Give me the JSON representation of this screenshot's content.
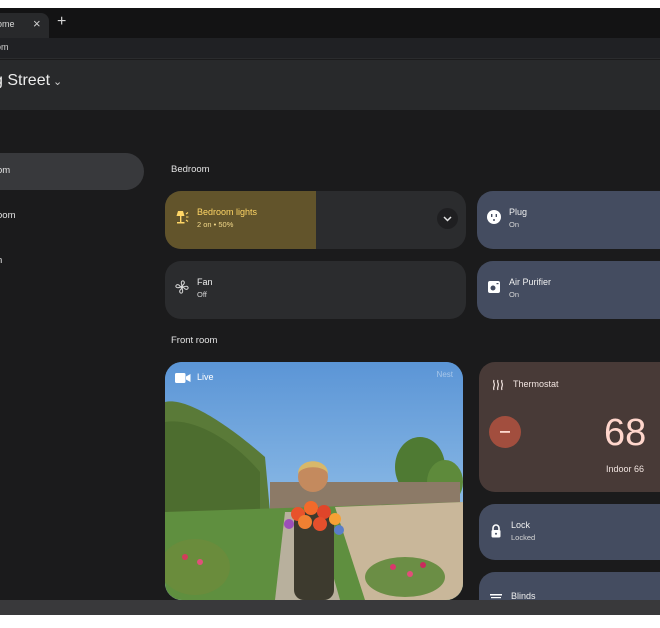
{
  "browser": {
    "tab_title": "ome",
    "close_glyph": "×",
    "new_tab_glyph": "+",
    "url": "om"
  },
  "header": {
    "home_name": "g Street",
    "chevron": "⌄"
  },
  "sidebar": {
    "items": [
      {
        "label": "om",
        "active": true
      },
      {
        "label": "oom",
        "active": false
      },
      {
        "label": "n",
        "active": false
      }
    ]
  },
  "sections": {
    "bedroom": "Bedroom",
    "front_room": "Front room"
  },
  "tiles": {
    "bedroom_lights": {
      "name": "Bedroom lights",
      "state": "2 on • 50%",
      "icon": "lamp-icon",
      "brightness": 0.5
    },
    "plug": {
      "name": "Plug",
      "state": "On",
      "icon": "outlet-icon"
    },
    "fan": {
      "name": "Fan",
      "state": "Off",
      "icon": "fan-icon"
    },
    "air_purifier": {
      "name": "Air Purifier",
      "state": "On",
      "icon": "air-purifier-icon"
    },
    "lock": {
      "name": "Lock",
      "state": "Locked",
      "icon": "lock-icon"
    },
    "blinds": {
      "name": "Blinds",
      "icon": "blinds-icon"
    }
  },
  "camera": {
    "live_label": "Live",
    "brand": "Nest",
    "icon": "video-camera-icon"
  },
  "thermostat": {
    "name": "Thermostat",
    "setpoint": "68",
    "indoor": "Indoor 66",
    "icon": "heat-icon",
    "minus_glyph": "−"
  },
  "colors": {
    "background": "#1b1b1c",
    "lights_active": "#62542b",
    "lights_text": "#ffd666",
    "blue_tile": "#444c60",
    "thermostat_tile": "#483a37",
    "thermostat_button": "#a24e3e"
  }
}
